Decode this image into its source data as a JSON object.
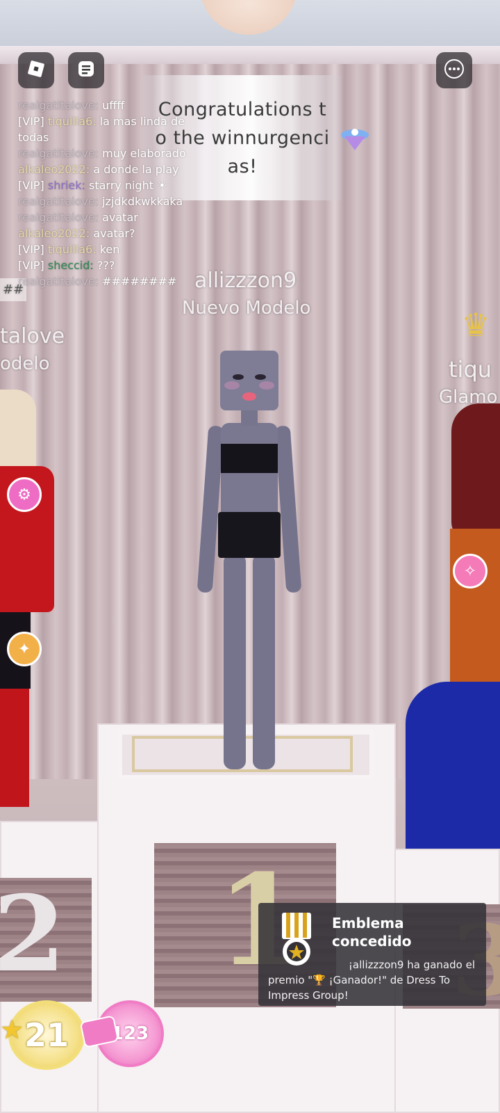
{
  "top_bar": {
    "roblox_menu_icon": "roblox-logo-icon",
    "chat_toggle_icon": "chat-icon",
    "more_options_icon": "more-horizontal-icon"
  },
  "banner": {
    "message": "Congratulations to the winnurgencias!"
  },
  "chat": {
    "messages": [
      {
        "tag": "",
        "user": "realgatitalove:",
        "text": "uffff"
      },
      {
        "tag": "[VIP]",
        "user": "tiquilla6:",
        "text": "la mas linda de todas"
      },
      {
        "tag": "",
        "user": "realgatitalove:",
        "text": "muy elaborado"
      },
      {
        "tag": "",
        "user": "alkaleo2022:",
        "text": "a donde la play"
      },
      {
        "tag": "[VIP]",
        "user": "shriek:",
        "text": "starry night ☀"
      },
      {
        "tag": "",
        "user": "realgatitalove:",
        "text": "jzjdkdkwkkaka"
      },
      {
        "tag": "",
        "user": "realgatitalove:",
        "text": "avatar"
      },
      {
        "tag": "",
        "user": "alkaleo2022:",
        "text": "avatar?"
      },
      {
        "tag": "[VIP]",
        "user": "tiquilla6:",
        "text": "ken"
      },
      {
        "tag": "[VIP]",
        "user": "sheccid:",
        "text": "???"
      },
      {
        "tag": "",
        "user": "realgatitalove:",
        "text": "########"
      }
    ]
  },
  "scene": {
    "center_player": {
      "name": "allizzzon9",
      "title": "Nuevo Modelo"
    },
    "left_player": {
      "name": "talove",
      "title": "odelo"
    },
    "right_player": {
      "name": "tiqu",
      "title": "Glamo"
    },
    "left_hash": "##",
    "podium_center_number": "1",
    "podium_left_number": "2",
    "podium_right_number": "3"
  },
  "stats": {
    "stars": "21",
    "tickets": "123"
  },
  "toast": {
    "title": "Emblema concedido",
    "body_line1": "¡allizzzon9 ha ganado el",
    "body_line2": "premio \"🏆 ¡Ganador!\" de Dress To Impress Group!",
    "icon": "medal-icon"
  },
  "colors": {
    "toast_bg": "#343238",
    "star_gold": "#f2df7a",
    "ticket_pink": "#f07cc6"
  }
}
